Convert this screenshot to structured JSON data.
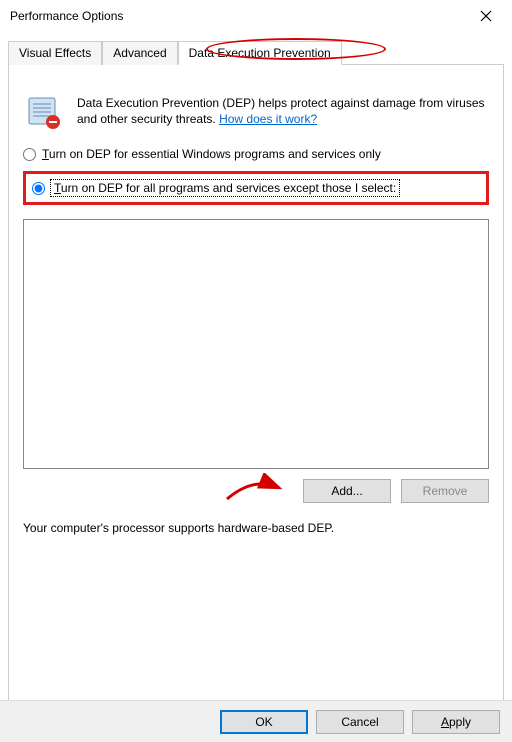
{
  "window": {
    "title": "Performance Options"
  },
  "tabs": {
    "visual_effects": "Visual Effects",
    "advanced": "Advanced",
    "dep": "Data Execution Prevention"
  },
  "intro": {
    "text_before_link": "Data Execution Prevention (DEP) helps protect against damage from viruses and other security threats. ",
    "link": "How does it work?"
  },
  "radios": {
    "essential": "Turn on DEP for essential Windows programs and services only",
    "all": "Turn on DEP for all programs and services except those I select:"
  },
  "buttons": {
    "add": "Add...",
    "remove": "Remove",
    "ok": "OK",
    "cancel": "Cancel",
    "apply": "Apply"
  },
  "status": "Your computer's processor supports hardware-based DEP."
}
